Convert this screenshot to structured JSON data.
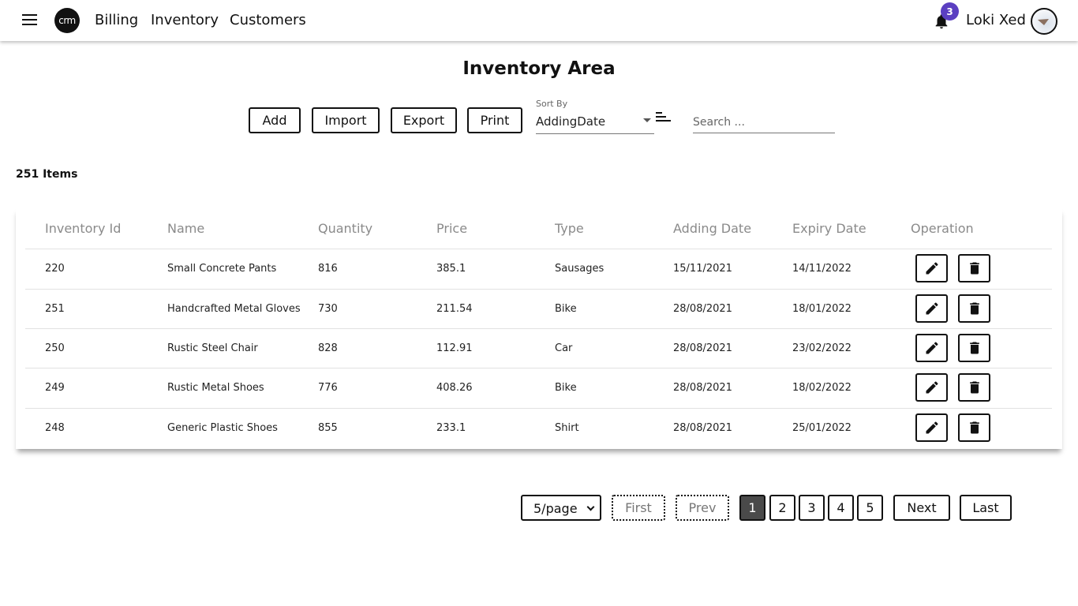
{
  "nav": {
    "logo_text": "crm",
    "links": [
      "Billing",
      "Inventory",
      "Customers"
    ],
    "notification_count": "3",
    "username": "Loki Xed"
  },
  "page": {
    "title": "Inventory Area",
    "buttons": {
      "add": "Add",
      "import": "Import",
      "export": "Export",
      "print": "Print"
    },
    "sort": {
      "label": "Sort By",
      "value": "AddingDate"
    },
    "search": {
      "placeholder": "Search ..."
    },
    "items_count": "251 Items"
  },
  "table": {
    "headers": [
      "Inventory Id",
      "Name",
      "Quantity",
      "Price",
      "Type",
      "Adding Date",
      "Expiry Date",
      "Operation"
    ],
    "rows": [
      [
        "220",
        "Small Concrete Pants",
        "816",
        "385.1",
        "Sausages",
        "15/11/2021",
        "14/11/2022"
      ],
      [
        "251",
        "Handcrafted Metal Gloves",
        "730",
        "211.54",
        "Bike",
        "28/08/2021",
        "18/01/2022"
      ],
      [
        "250",
        "Rustic Steel Chair",
        "828",
        "112.91",
        "Car",
        "28/08/2021",
        "23/02/2022"
      ],
      [
        "249",
        "Rustic Metal Shoes",
        "776",
        "408.26",
        "Bike",
        "28/08/2021",
        "18/02/2022"
      ],
      [
        "248",
        "Generic Plastic Shoes",
        "855",
        "233.1",
        "Shirt",
        "28/08/2021",
        "25/01/2022"
      ]
    ]
  },
  "pagination": {
    "page_size": "5/page",
    "first": "First",
    "prev": "Prev",
    "pages": [
      "1",
      "2",
      "3",
      "4",
      "5"
    ],
    "active_page": "1",
    "next": "Next",
    "last": "Last"
  },
  "colors": {
    "badge": "#5b3fc1",
    "active_page": "#4a4a4a"
  },
  "icons": [
    "menu-icon",
    "bell-icon",
    "sort-order-icon",
    "edit-icon",
    "delete-icon"
  ]
}
